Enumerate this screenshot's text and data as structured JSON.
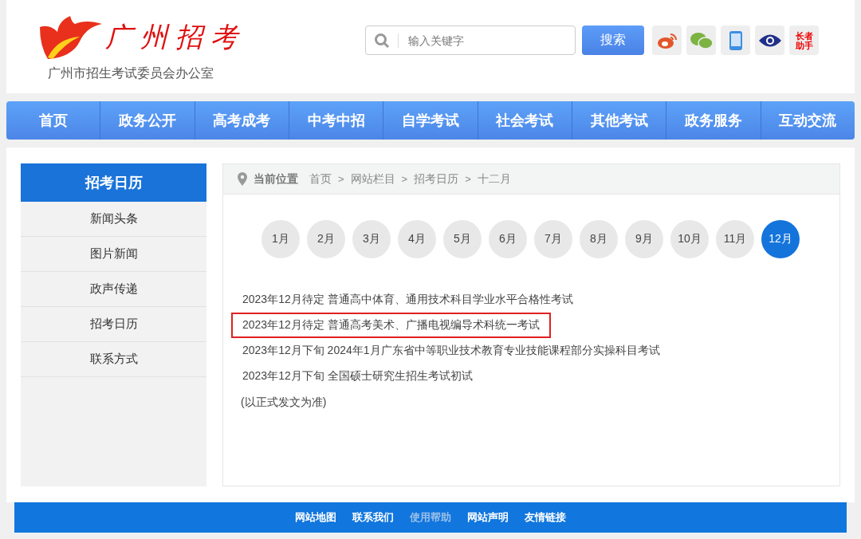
{
  "header": {
    "logo_text": "广州招考",
    "org_name": "广州市招生考试委员会办公室",
    "search": {
      "placeholder": "输入关键字",
      "button": "搜索"
    },
    "elder_button": "长者助手"
  },
  "nav": [
    "首页",
    "政务公开",
    "高考成考",
    "中考中招",
    "自学考试",
    "社会考试",
    "其他考试",
    "政务服务",
    "互动交流"
  ],
  "sidebar": {
    "title": "招考日历",
    "items": [
      "新闻头条",
      "图片新闻",
      "政声传递",
      "招考日历",
      "联系方式"
    ]
  },
  "breadcrumb": {
    "label": "当前位置",
    "separator": ">",
    "items": [
      "首页",
      "网站栏目",
      "招考日历",
      "十二月"
    ]
  },
  "months": [
    {
      "label": "1月",
      "selected": false
    },
    {
      "label": "2月",
      "selected": false
    },
    {
      "label": "3月",
      "selected": false
    },
    {
      "label": "4月",
      "selected": false
    },
    {
      "label": "5月",
      "selected": false
    },
    {
      "label": "6月",
      "selected": false
    },
    {
      "label": "7月",
      "selected": false
    },
    {
      "label": "8月",
      "selected": false
    },
    {
      "label": "9月",
      "selected": false
    },
    {
      "label": "10月",
      "selected": false
    },
    {
      "label": "11月",
      "selected": false
    },
    {
      "label": "12月",
      "selected": true
    }
  ],
  "events": [
    {
      "text": "2023年12月待定 普通高中体育、通用技术科目学业水平合格性考试",
      "highlighted": false
    },
    {
      "text": "2023年12月待定 普通高考美术、广播电视编导术科统一考试",
      "highlighted": true
    },
    {
      "text": "2023年12月下旬 2024年1月广东省中等职业技术教育专业技能课程部分实操科目考试",
      "highlighted": false
    },
    {
      "text": "2023年12月下旬 全国硕士研究生招生考试初试",
      "highlighted": false
    }
  ],
  "note": "(以正式发文为准)",
  "footer": [
    {
      "label": "网站地图",
      "dimmed": false
    },
    {
      "label": "联系我们",
      "dimmed": false
    },
    {
      "label": "使用帮助",
      "dimmed": true
    },
    {
      "label": "网站声明",
      "dimmed": false
    },
    {
      "label": "友情链接",
      "dimmed": false
    }
  ]
}
